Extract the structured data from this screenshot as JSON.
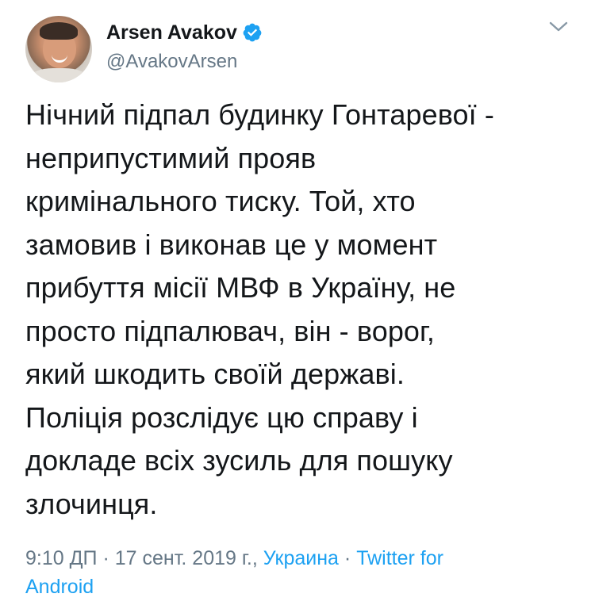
{
  "author": {
    "display_name": "Arsen Avakov",
    "handle": "@AvakovArsen",
    "verified": true,
    "avatar_icon": "profile-photo"
  },
  "menu": {
    "icon": "chevron-down-icon"
  },
  "tweet": {
    "text": "Нічний підпал будинку Гонтаревої -\nнеприпустимий прояв\nкримінального тиску. Той, хто\nзамовив і виконав це у момент\nприбуття місії МВФ в Україну, не\nпросто підпалювач, він - ворог,\nякий шкодить своїй державі.\n Поліція розслідує цю справу і\nдокладе всіх зусиль для пошуку\nзлочинця."
  },
  "meta": {
    "time": "9:10 ДП",
    "separator": "·",
    "date": "17 сент. 2019 г.,",
    "location": "Украина",
    "source_line1": "Twitter for",
    "source_line2": "Android"
  },
  "colors": {
    "text": "#14171a",
    "secondary": "#657786",
    "link": "#1da1f2",
    "verified_badge": "#1da1f2"
  }
}
